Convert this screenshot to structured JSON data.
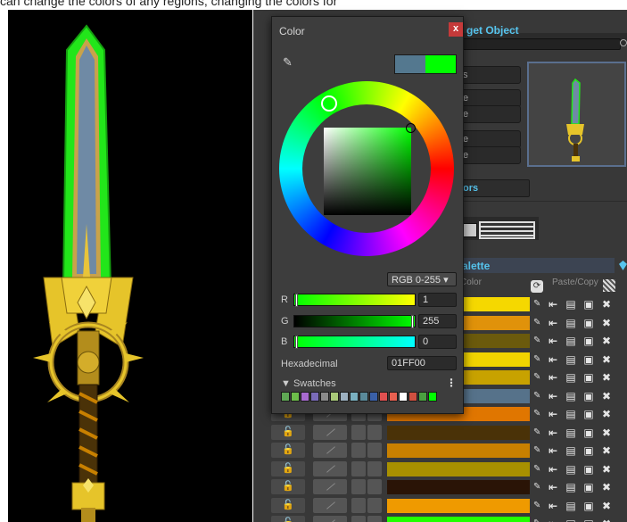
{
  "top_text": "can change the colors of any regions, changing the colors for",
  "inspector": {
    "title": "get Object",
    "fields": [
      "s",
      "e",
      "e",
      "e",
      "e"
    ],
    "colors_button": "ors",
    "palette_header": "alette",
    "col_color": "Color",
    "col_paste_copy": "Paste/Copy",
    "rows": [
      {
        "color": "#f5d800"
      },
      {
        "color": "#e0920a"
      },
      {
        "color": "#6b5a0c"
      },
      {
        "color": "#f1d400"
      },
      {
        "color": "#c8a200"
      },
      {
        "color": "#56728a"
      },
      {
        "color": "#e07600"
      },
      {
        "color": "#4a3208"
      },
      {
        "color": "#c88000"
      },
      {
        "color": "#a89000"
      },
      {
        "color": "#2a1406"
      },
      {
        "color": "#ef9a00"
      },
      {
        "color": "#22ff00"
      }
    ],
    "lock_glyph": "🔓"
  },
  "color_window": {
    "title": "Color",
    "close": "x",
    "preview_old": "#54788f",
    "preview_new": "#00ff00",
    "mode": "RGB 0-255 ▾",
    "r_label": "R",
    "r_value": "1",
    "g_label": "G",
    "g_value": "255",
    "b_label": "B",
    "b_value": "0",
    "hex_label": "Hexadecimal",
    "hex_value": "01FF00",
    "swatches_label": "▼ Swatches",
    "swatches_menu": "⋮",
    "swatches": [
      "#5fa854",
      "#6dbd4a",
      "#a86ad0",
      "#7a6bb8",
      "#8a8a8a",
      "#a8c878",
      "#9cb0c0",
      "#7ab0c0",
      "#5a8a9a",
      "#3a60a8",
      "#e05050",
      "#e86050",
      "#ffffff",
      "#d05040",
      "#4aa040",
      "#00ff00"
    ]
  }
}
